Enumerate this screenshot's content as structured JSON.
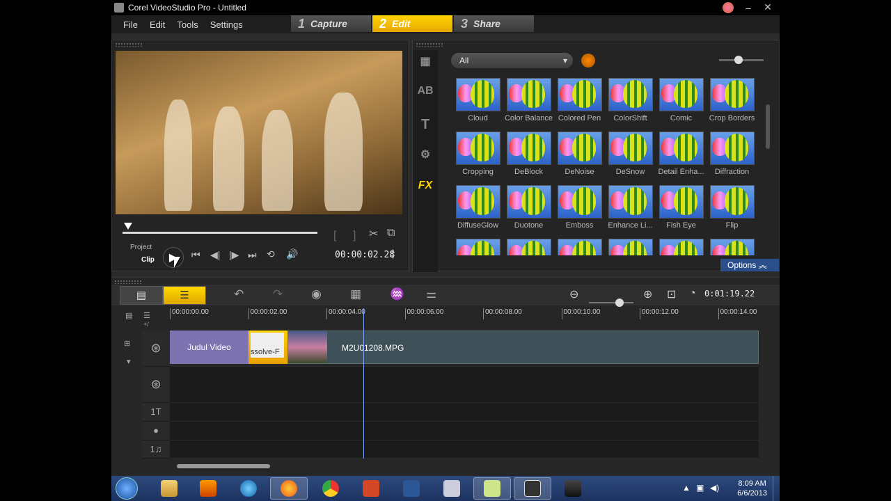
{
  "window": {
    "title": "Corel VideoStudio Pro - Untitled"
  },
  "menu": [
    "File",
    "Edit",
    "Tools",
    "Settings"
  ],
  "steps": [
    {
      "num": "1",
      "label": "Capture"
    },
    {
      "num": "2",
      "label": "Edit"
    },
    {
      "num": "3",
      "label": "Share"
    }
  ],
  "preview": {
    "project_label": "Project",
    "clip_label": "Clip",
    "timecode": "00:00:02.28"
  },
  "library": {
    "filter": "All",
    "side_icons": [
      "media-icon",
      "transition-icon",
      "title-icon",
      "graphic-icon",
      "fx-icon"
    ],
    "fx_label": "FX",
    "ab_label": "AB",
    "t_label": "T",
    "options_label": "Options",
    "filters": [
      "Cloud",
      "Color Balance",
      "Colored Pen",
      "ColorShift",
      "Comic",
      "Crop Borders",
      "Cropping",
      "DeBlock",
      "DeNoise",
      "DeSnow",
      "Detail Enha...",
      "Diffraction",
      "DiffuseGlow",
      "Duotone",
      "Emboss",
      "Enhance Li...",
      "Fish Eye",
      "Flip",
      "",
      "",
      "",
      "",
      "",
      ""
    ]
  },
  "timeline": {
    "project_time": "0:01:19.22",
    "ruler": [
      "00:00:00.00",
      "00:00:02.00",
      "00:00:04.00",
      "00:00:06.00",
      "00:00:08.00",
      "00:00:10.00",
      "00:00:12.00",
      "00:00:14.00"
    ],
    "clips": {
      "title_clip": "Judul Video",
      "transition_clip": "ssolve-F",
      "video_clip": "M2U01208.MPG"
    }
  },
  "taskbar": {
    "time": "8:09 AM",
    "date": "6/6/2013"
  },
  "colors": {
    "accent_yellow": "#ffd200",
    "panel_bg": "#242424",
    "title_clip": "#7c73b0",
    "video_clip": "#3e5158",
    "taskbar": "#1c3260"
  }
}
